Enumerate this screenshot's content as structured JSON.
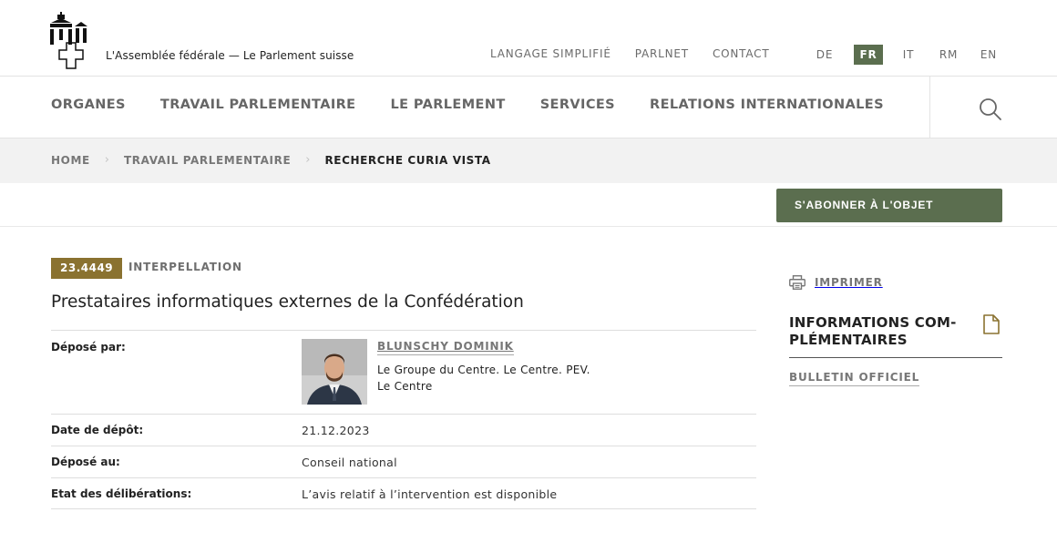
{
  "header": {
    "site_name": "L'Assemblée fédérale — Le Parlement suisse",
    "service_links": [
      "LANGAGE SIMPLIFIÉ",
      "PARLNET",
      "CONTACT"
    ],
    "languages": [
      {
        "code": "DE",
        "active": false
      },
      {
        "code": "FR",
        "active": true
      },
      {
        "code": "IT",
        "active": false
      },
      {
        "code": "RM",
        "active": false
      },
      {
        "code": "EN",
        "active": false
      }
    ],
    "accent_color": "#5b6e4f"
  },
  "main_nav": {
    "items": [
      "ORGANES",
      "TRAVAIL PARLEMENTAIRE",
      "LE PARLEMENT",
      "SERVICES",
      "RELATIONS INTERNATIONALES"
    ],
    "search_icon": "search-icon"
  },
  "breadcrumb": {
    "items": [
      "HOME",
      "TRAVAIL PARLEMENTAIRE"
    ],
    "current": "RECHERCHE CURIA VISTA"
  },
  "actions": {
    "subscribe_label": "S'ABONNER À L'OBJET"
  },
  "business": {
    "number": "23.4449",
    "number_color": "#8a7230",
    "type": "INTERPELLATION",
    "title": "Prestataires informatiques externes de la Confédération",
    "author_label": "Déposé par:",
    "author_name": "BLUNSCHY DOMINIK",
    "author_group": "Le Groupe du Centre. Le Centre. PEV.",
    "author_party": "Le Centre",
    "date_label": "Date de dépôt:",
    "date_value": "21.12.2023",
    "council_label": "Déposé au:",
    "council_value": "Conseil national",
    "status_label": "Etat des délibérations:",
    "status_value": "L’avis relatif à l’intervention est disponible"
  },
  "sidebar": {
    "print_label": "IMPRIMER",
    "info_heading_line1": "INFORMATIONS COM-",
    "info_heading_line2": "PLÉMENTAIRES",
    "bulletin_label": "BULLETIN OFFICIEL"
  }
}
